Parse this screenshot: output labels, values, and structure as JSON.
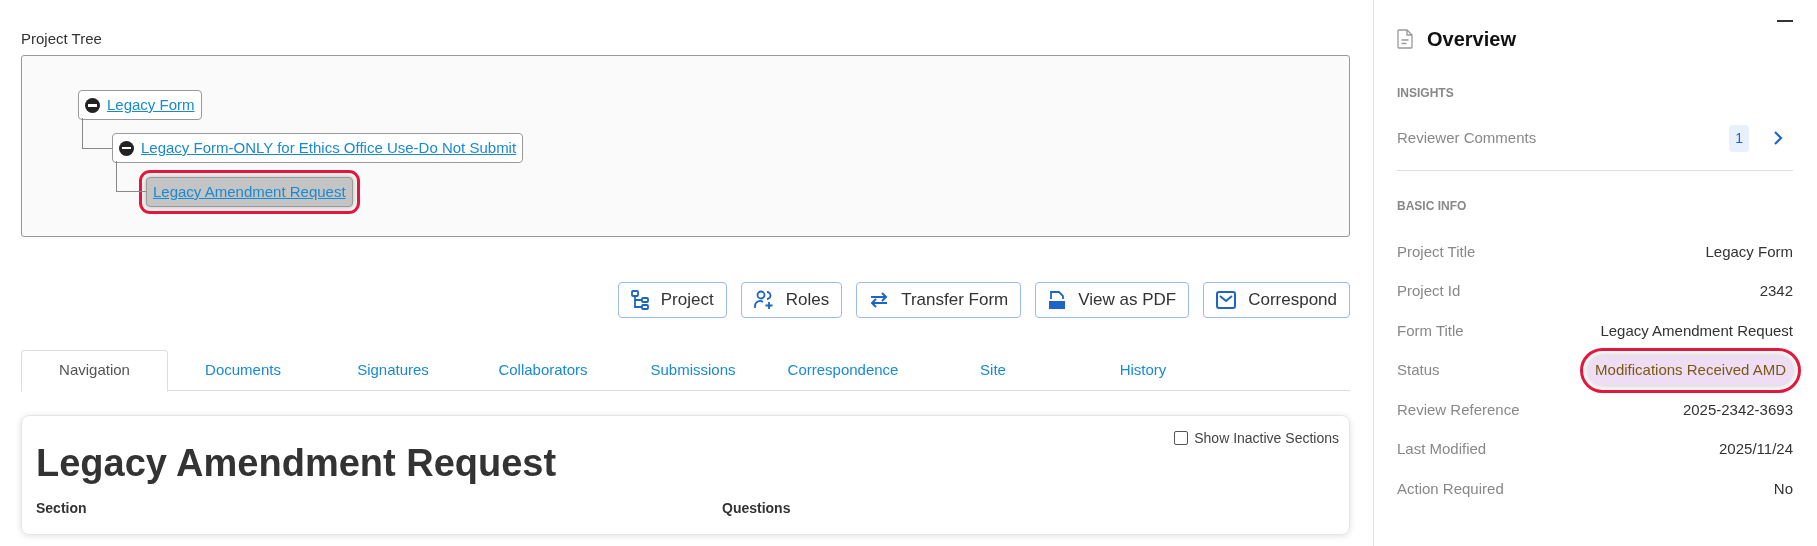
{
  "project_tree": {
    "label": "Project Tree",
    "nodes": [
      {
        "label": "Legacy Form",
        "expanded": true,
        "highlighted": false,
        "children": [
          {
            "label": "Legacy Form-ONLY for Ethics Office Use-Do Not Submit",
            "expanded": true,
            "highlighted": false,
            "children": [
              {
                "label": "Legacy Amendment Request",
                "highlighted": true
              }
            ]
          }
        ]
      }
    ]
  },
  "actions": [
    {
      "kind": "tree",
      "label": "Project"
    },
    {
      "kind": "roles",
      "label": "Roles"
    },
    {
      "kind": "transfer",
      "label": "Transfer Form"
    },
    {
      "kind": "pdf",
      "label": "View as PDF"
    },
    {
      "kind": "mail",
      "label": "Correspond"
    }
  ],
  "tabs": [
    {
      "label": "Navigation",
      "selected": true
    },
    {
      "label": "Documents",
      "selected": false
    },
    {
      "label": "Signatures",
      "selected": false
    },
    {
      "label": "Collaborators",
      "selected": false
    },
    {
      "label": "Submissions",
      "selected": false
    },
    {
      "label": "Correspondence",
      "selected": false
    },
    {
      "label": "Site",
      "selected": false
    },
    {
      "label": "History",
      "selected": false
    }
  ],
  "form": {
    "title": "Legacy Amendment Request",
    "show_inactive": {
      "label": "Show Inactive Sections",
      "checked": false
    },
    "columns": [
      "Section",
      "Questions"
    ]
  },
  "overview": {
    "title": "Overview",
    "insights": {
      "heading": "INSIGHTS",
      "items": [
        {
          "label": "Reviewer Comments",
          "count": "1"
        }
      ]
    },
    "basic_info": {
      "heading": "BASIC INFO",
      "rows": [
        {
          "label": "Project Title",
          "value": "Legacy Form"
        },
        {
          "label": "Project Id",
          "value": "2342"
        },
        {
          "label": "Form Title",
          "value": "Legacy Amendment Request"
        },
        {
          "label": "Status",
          "value": "Modifications Received AMD",
          "kind": "badge",
          "color": "#efdcf5",
          "highlighted": true
        },
        {
          "label": "Review Reference",
          "value": "2025-2342-3693"
        },
        {
          "label": "Last Modified",
          "value": "2025/11/24"
        },
        {
          "label": "Action Required",
          "value": "No"
        }
      ]
    }
  }
}
